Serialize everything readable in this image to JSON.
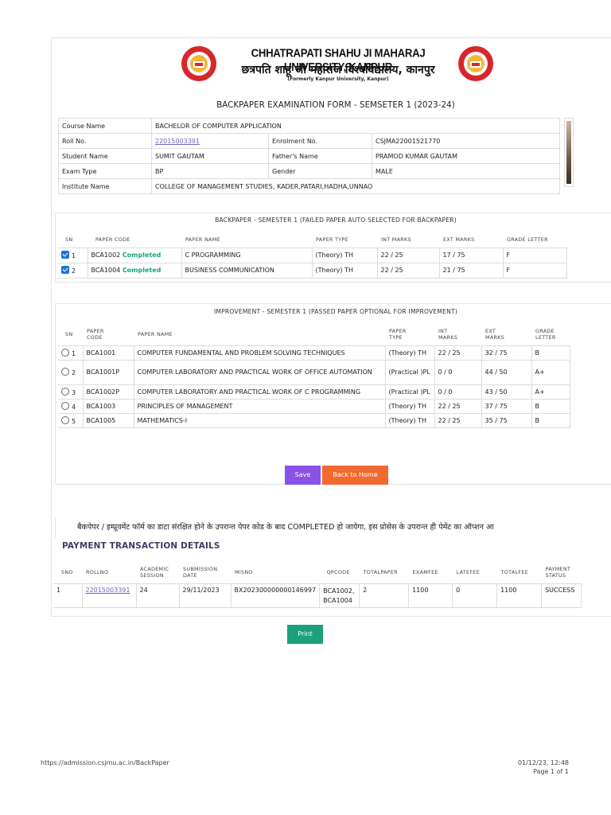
{
  "university": {
    "name_en": "CHHATRAPATI SHAHU JI MAHARAJ UNIVERSITY, KANPUR",
    "name_hi": "छत्रपति शाहू जी महाराज विश्वविद्यालय, कानपुर",
    "formerly": "(Formerly Kanpur University, Kanpur)"
  },
  "form_title": "BACKPAPER EXAMINATION FORM - SEMSETER 1 (2023-24)",
  "info": {
    "course_label": "Course Name",
    "course_value": "BACHELOR OF COMPUTER APPLICATION",
    "roll_label": "Roll No.",
    "roll_value": "22015003391",
    "enrol_label": "Enrolment No.",
    "enrol_value": "CSJMA22001521770",
    "student_label": "Student Name",
    "student_value": "SUMIT GAUTAM",
    "father_label": "Father's Name",
    "father_value": "PRAMOD KUMAR GAUTAM",
    "examtype_label": "Exam Type",
    "examtype_value": "BP",
    "gender_label": "Gender",
    "gender_value": "MALE",
    "institute_label": "Institute Name",
    "institute_value": "COLLEGE OF MANAGEMENT STUDIES, KADER,PATARI,HADHA,UNNAO"
  },
  "backpaper": {
    "title": "BACKPAPER - SEMESTER 1 (FAILED PAPER AUTO SELECTED FOR BACKPAPER)",
    "headers": [
      "SN",
      "PAPER CODE",
      "PAPER NAME",
      "PAPER TYPE",
      "INT MARKS",
      "EXT MARKS",
      "GRADE LETTER"
    ],
    "rows": [
      {
        "sn": "1",
        "code": "BCA1002",
        "status": "Completed",
        "name": "C PROGRAMMING",
        "type": "(Theory) TH",
        "int": "22 / 25",
        "ext": "17 / 75",
        "grade": "F"
      },
      {
        "sn": "2",
        "code": "BCA1004",
        "status": "Completed",
        "name": "BUSINESS COMMUNICATION",
        "type": "(Theory) TH",
        "int": "22 / 25",
        "ext": "21 / 75",
        "grade": "F"
      }
    ]
  },
  "improvement": {
    "title": "IMPROVEMENT - SEMESTER 1 (PASSED PAPER OPTIONAL FOR IMPROVEMENT)",
    "headers": {
      "sn": "SN",
      "code1": "PAPER",
      "code2": "CODE",
      "name": "PAPER NAME",
      "type1": "PAPER",
      "type2": "TYPE",
      "int1": "INT",
      "int2": "MARKS",
      "ext1": "EXT",
      "ext2": "MARKS",
      "grade1": "GRADE",
      "grade2": "LETTER"
    },
    "rows": [
      {
        "sn": "1",
        "code": "BCA1001",
        "name": "COMPUTER FUNDAMENTAL AND PROBLEM SOLVING TECHNIQUES",
        "type": "(Theory) TH",
        "int": "22 / 25",
        "ext": "32 / 75",
        "grade": "B"
      },
      {
        "sn": "2",
        "code": "BCA1001P",
        "name": "COMPUTER LABORATORY AND PRACTICAL WORK OF OFFICE AUTOMATION",
        "type": "(Practical )PL",
        "int": "0 / 0",
        "ext": "44 / 50",
        "grade": "A+"
      },
      {
        "sn": "3",
        "code": "BCA1002P",
        "name": "COMPUTER LABORATORY AND PRACTICAL WORK OF C PROGRAMMING",
        "type": "(Practical )PL",
        "int": "0 / 0",
        "ext": "43 / 50",
        "grade": "A+"
      },
      {
        "sn": "4",
        "code": "BCA1003",
        "name": "PRINCIPLES OF MANAGEMENT",
        "type": "(Theory) TH",
        "int": "22 / 25",
        "ext": "37 / 75",
        "grade": "B"
      },
      {
        "sn": "5",
        "code": "BCA1005",
        "name": "MATHEMATICS-I",
        "type": "(Theory) TH",
        "int": "22 / 25",
        "ext": "35 / 75",
        "grade": "B"
      }
    ]
  },
  "buttons": {
    "save": "Save",
    "home": "Back to Home",
    "print": "Print"
  },
  "notice": "बैकपेपर / इम्प्रूवमेंट फॉर्म का डाटा संरक्षित होने के उपरान्त पेपर कोड के बाद COMPLETED हो जायेगा, इस प्रोसेस के उपरान्त ही पेमेंट का ऑप्शन आ",
  "payment": {
    "title": "PAYMENT TRANSACTION DETAILS",
    "headers": {
      "sno": "SNO",
      "roll": "ROLLNO",
      "sess1": "ACADEMIC",
      "sess2": "SESSION",
      "date1": "SUBMISSION",
      "date2": "DATE",
      "misno": "MISNO",
      "qp": "QPCODE",
      "total": "TOTALPAPER",
      "exam": "EXAMFEE",
      "late": "LATEFEE",
      "tfee": "TOTALFEE",
      "stat1": "PAYMENT",
      "stat2": "STATUS"
    },
    "row": {
      "sno": "1",
      "roll": "22015003391",
      "session": "24",
      "date": "29/11/2023",
      "misno": "BX202300000000146997",
      "qp1": "BCA1002,",
      "qp2": "BCA1004",
      "total": "2",
      "exam": "1100",
      "late": "0",
      "tfee": "1100",
      "status": "SUCCESS"
    }
  },
  "footer": {
    "url": "https://admission.csjmu.ac.in/BackPaper",
    "date": "01/12/23, 12:48",
    "page": "Page 1 of 1"
  }
}
